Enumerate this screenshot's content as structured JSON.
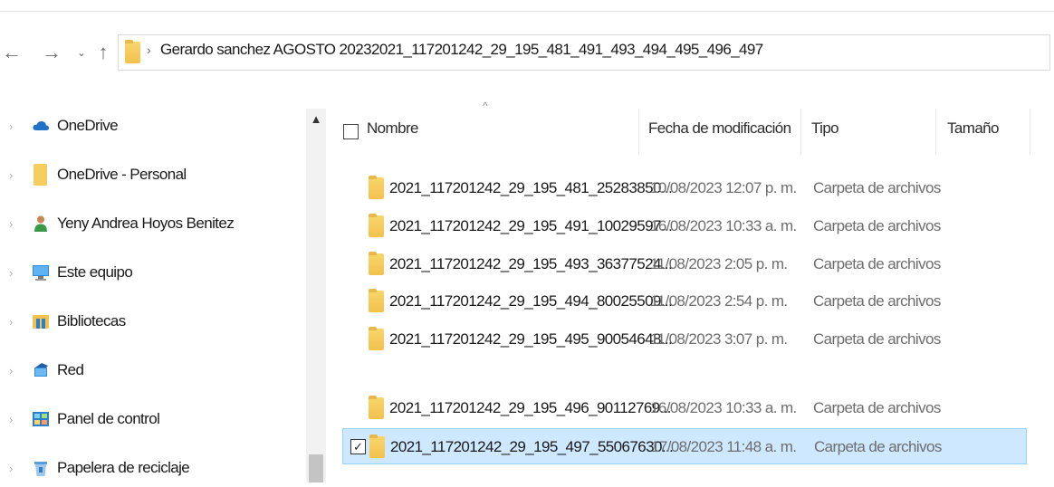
{
  "nav": {
    "back_icon": "arrow-left-icon",
    "forward_icon": "arrow-right-icon",
    "recent_icon": "chevron-down-icon",
    "up_icon": "arrow-up-icon",
    "back": "←",
    "forward": "→",
    "recent": "⌄",
    "up": "↑"
  },
  "breadcrumb": [
    "Gerardo sanchez AGOSTO 2023",
    "2021_117201242_29_195_481_491_493_494_495_496_497"
  ],
  "sidebar": {
    "items": [
      {
        "label": "OneDrive",
        "icon": "cloud-icon"
      },
      {
        "label": "OneDrive - Personal",
        "icon": "folder-icon"
      },
      {
        "label": "Yeny Andrea Hoyos Benitez",
        "icon": "user-icon"
      },
      {
        "label": "Este equipo",
        "icon": "computer-icon"
      },
      {
        "label": "Bibliotecas",
        "icon": "library-icon"
      },
      {
        "label": "Red",
        "icon": "network-icon"
      },
      {
        "label": "Panel de control",
        "icon": "control-panel-icon"
      },
      {
        "label": "Papelera de reciclaje",
        "icon": "recycle-bin-icon"
      }
    ]
  },
  "columns": {
    "name": "Nombre",
    "date": "Fecha de modificación",
    "type": "Tipo",
    "size": "Tamaño"
  },
  "files": [
    {
      "name": "2021_117201242_29_195_481_25283850...",
      "date": "10/08/2023 12:07 p. m.",
      "type": "Carpeta de archivos",
      "selected": false
    },
    {
      "name": "2021_117201242_29_195_491_10029597...",
      "date": "16/08/2023 10:33 a. m.",
      "type": "Carpeta de archivos",
      "selected": false
    },
    {
      "name": "2021_117201242_29_195_493_36377524...",
      "date": "11/08/2023 2:05 p. m.",
      "type": "Carpeta de archivos",
      "selected": false
    },
    {
      "name": "2021_117201242_29_195_494_80025509...",
      "date": "11/08/2023 2:54 p. m.",
      "type": "Carpeta de archivos",
      "selected": false
    },
    {
      "name": "2021_117201242_29_195_495_90054648...",
      "date": "11/08/2023 3:07 p. m.",
      "type": "Carpeta de archivos",
      "selected": false
    },
    {
      "name": "2021_117201242_29_195_496_90112769...",
      "date": "16/08/2023 10:33 a. m.",
      "type": "Carpeta de archivos",
      "selected": false
    },
    {
      "name": "2021_117201242_29_195_497_55067630...",
      "date": "17/08/2023 11:48 a. m.",
      "type": "Carpeta de archivos",
      "selected": true
    }
  ],
  "colors": {
    "selection_bg": "#cde8ff",
    "selection_border": "#99d1ff",
    "folder": "#f2c14e"
  }
}
